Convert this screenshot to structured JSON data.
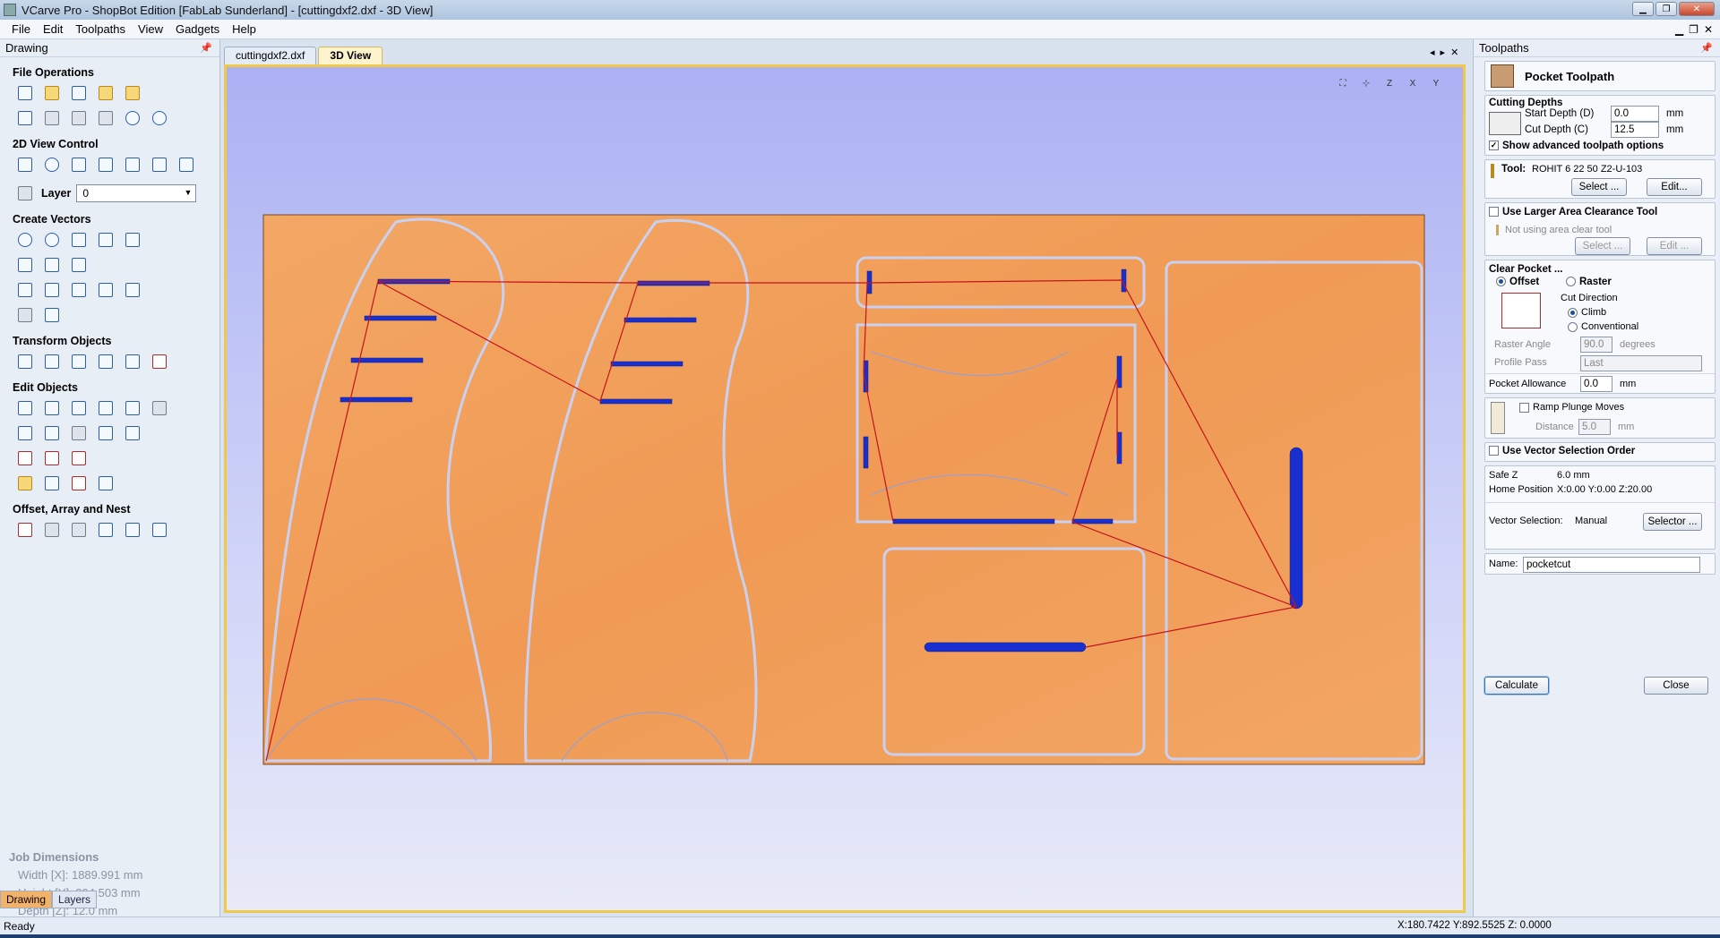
{
  "window": {
    "title": "VCarve Pro - ShopBot Edition [FabLab Sunderland] - [cuttingdxf2.dxf - 3D View]"
  },
  "menu": [
    "File",
    "Edit",
    "Toolpaths",
    "View",
    "Gadgets",
    "Help"
  ],
  "left_panel": {
    "title": "Drawing",
    "sections": {
      "file_ops": "File Operations",
      "view_2d": "2D View Control",
      "create_vectors": "Create Vectors",
      "transform": "Transform Objects",
      "edit_objects": "Edit Objects",
      "offset": "Offset, Array and Nest"
    },
    "layer_label": "Layer",
    "layer_value": "0",
    "job_dimensions": {
      "heading": "Job Dimensions",
      "width": "Width  [X]: 1889.991 mm",
      "height": "Height [Y]: 894.503 mm",
      "depth": "Depth  [Z]: 12.0 mm"
    },
    "tabs": [
      "Drawing",
      "Layers"
    ]
  },
  "doc_tabs": [
    "cuttingdxf2.dxf",
    "3D View"
  ],
  "right_panel": {
    "title": "Toolpaths",
    "header": "Pocket Toolpath",
    "cutting_depths": {
      "label": "Cutting Depths",
      "start_label": "Start Depth (D)",
      "start_value": "0.0",
      "cut_label": "Cut Depth (C)",
      "cut_value": "12.5",
      "unit": "mm",
      "advanced": "Show advanced toolpath options"
    },
    "tool": {
      "label": "Tool:",
      "name": "ROHIT 6 22 50   Z2-U-103",
      "select": "Select ...",
      "edit": "Edit..."
    },
    "area_clear": {
      "label": "Use Larger Area Clearance Tool",
      "note": "Not using area clear tool",
      "select": "Select ...",
      "edit": "Edit ..."
    },
    "clear_pocket": {
      "label": "Clear Pocket ...",
      "offset": "Offset",
      "raster": "Raster",
      "cut_direction": "Cut Direction",
      "climb": "Climb",
      "conventional": "Conventional",
      "raster_angle_label": "Raster Angle",
      "raster_angle_value": "90.0",
      "raster_angle_unit": "degrees",
      "profile_pass_label": "Profile Pass",
      "profile_pass_value": "Last",
      "allowance_label": "Pocket Allowance",
      "allowance_value": "0.0",
      "allowance_unit": "mm"
    },
    "ramp": {
      "label": "Ramp Plunge Moves",
      "distance_label": "Distance",
      "distance_value": "5.0",
      "distance_unit": "mm"
    },
    "vector_order": "Use Vector Selection Order",
    "safe_z_label": "Safe Z",
    "safe_z_value": "6.0 mm",
    "home_label": "Home Position",
    "home_value": "X:0.00 Y:0.00 Z:20.00",
    "vector_sel_label": "Vector Selection:",
    "vector_sel_value": "Manual",
    "selector_btn": "Selector ...",
    "name_label": "Name:",
    "name_value": "pocketcut",
    "calculate": "Calculate",
    "close": "Close"
  },
  "status": {
    "left": "Ready",
    "coords": "X:180.7422 Y:892.5525 Z: 0.0000"
  },
  "colors": {
    "board": "#f2a25e",
    "view_top": "#abb1f3",
    "toolpath": "#1a2fd0",
    "rapid": "#c4141c"
  }
}
